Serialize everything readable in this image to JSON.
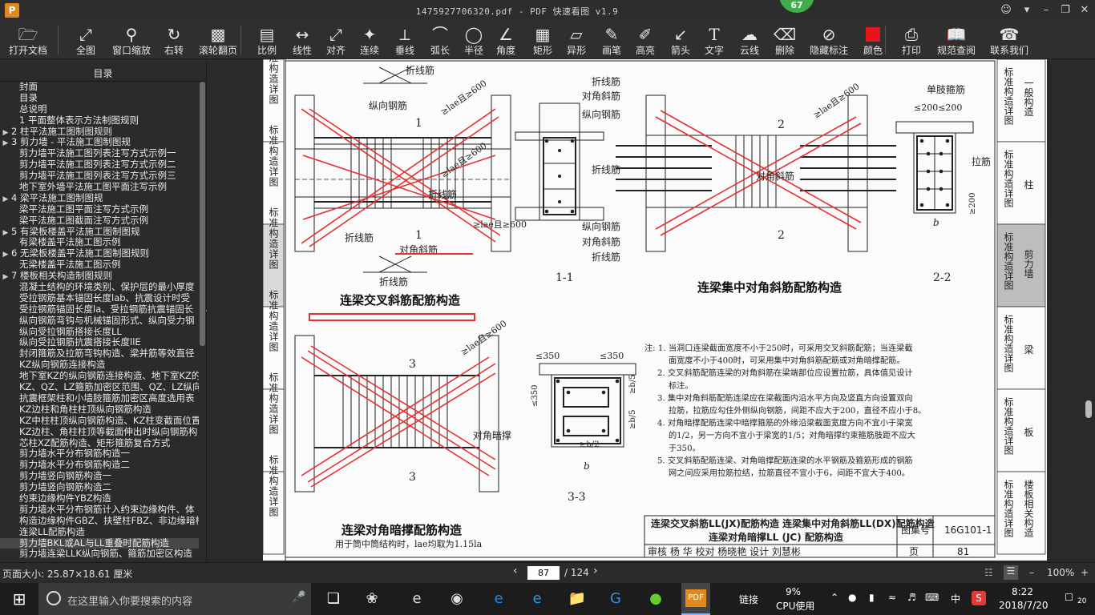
{
  "window": {
    "title": "1475927706320.pdf - PDF 快速看图 v1.9",
    "badge": "67",
    "logo": "P"
  },
  "toolbar": [
    {
      "name": "open",
      "label": "打开文档",
      "icon": "folder-icon"
    },
    {
      "name": "fit",
      "label": "全图",
      "icon": "fit-screen-icon"
    },
    {
      "name": "zoom-window",
      "label": "窗口缩放",
      "icon": "magnifier-icon"
    },
    {
      "name": "rotate",
      "label": "右转",
      "icon": "rotate-icon"
    },
    {
      "name": "scroll-page",
      "label": "滚轮翻页",
      "icon": "mouse-icon"
    },
    {
      "name": "scale",
      "label": "比例",
      "icon": "ruler-icon"
    },
    {
      "name": "linear",
      "label": "线性",
      "icon": "linear-dimension-icon"
    },
    {
      "name": "aligned",
      "label": "对齐",
      "icon": "aligned-dimension-icon"
    },
    {
      "name": "continuous",
      "label": "连续",
      "icon": "continuous-dimension-icon"
    },
    {
      "name": "perpendicular",
      "label": "垂线",
      "icon": "perpendicular-icon"
    },
    {
      "name": "arc-length",
      "label": "弧长",
      "icon": "arc-length-icon"
    },
    {
      "name": "radius",
      "label": "半径",
      "icon": "radius-icon"
    },
    {
      "name": "angle",
      "label": "角度",
      "icon": "angle-icon"
    },
    {
      "name": "rectangle",
      "label": "矩形",
      "icon": "rectangle-icon"
    },
    {
      "name": "irregular",
      "label": "异形",
      "icon": "irregular-shape-icon"
    },
    {
      "name": "pen",
      "label": "画笔",
      "icon": "pen-icon"
    },
    {
      "name": "highlight",
      "label": "高亮",
      "icon": "highlighter-icon"
    },
    {
      "name": "arrow",
      "label": "箭头",
      "icon": "arrow-icon"
    },
    {
      "name": "text",
      "label": "文字",
      "icon": "text-icon"
    },
    {
      "name": "cloud",
      "label": "云线",
      "icon": "cloud-line-icon"
    },
    {
      "name": "delete",
      "label": "删除",
      "icon": "eraser-icon"
    },
    {
      "name": "hide-marks",
      "label": "隐藏标注",
      "icon": "eye-hidden-icon"
    },
    {
      "name": "color",
      "label": "颜色",
      "icon": "color-swatch-icon",
      "color": "#e8141c"
    },
    {
      "name": "print",
      "label": "打印",
      "icon": "printer-icon"
    },
    {
      "name": "standards",
      "label": "规范查阅",
      "icon": "book-icon"
    },
    {
      "name": "contact",
      "label": "联系我们",
      "icon": "headset-icon"
    }
  ],
  "sidebar": {
    "title": "目录",
    "items": [
      {
        "text": "封面",
        "arrow": false
      },
      {
        "text": "目录",
        "arrow": false
      },
      {
        "text": "总说明",
        "arrow": false
      },
      {
        "text": "1 平面整体表示方法制图规则",
        "arrow": false
      },
      {
        "text": "2 柱平法施工图制图规则",
        "arrow": true
      },
      {
        "text": "3 剪力墙 - 平法施工图制图规",
        "arrow": true
      },
      {
        "text": "剪力墙平法施工图列表注写方式示例一",
        "arrow": false
      },
      {
        "text": "剪力墙平法施工图列表注写方式示例二",
        "arrow": false
      },
      {
        "text": "剪力墙平法施工图列表注写方式示例三",
        "arrow": false
      },
      {
        "text": "地下室外墙平法施工图平面注写示例",
        "arrow": false
      },
      {
        "text": "4 梁平法施工图制图规",
        "arrow": true
      },
      {
        "text": "梁平法施工图平面注写方式示例",
        "arrow": false
      },
      {
        "text": "梁平法施工图截面注写方式示例",
        "arrow": false
      },
      {
        "text": "5 有梁板楼盖平法施工图制图规",
        "arrow": true
      },
      {
        "text": "有梁楼盖平法施工图示例",
        "arrow": false
      },
      {
        "text": "6 无梁板楼盖平法施工图制图规则",
        "arrow": true
      },
      {
        "text": "无梁楼盖平法施工图示例",
        "arrow": false
      },
      {
        "text": "7 楼板相关构造制图规则",
        "arrow": true
      },
      {
        "text": "混凝土结构的环境类别、保护层的最小厚度",
        "arrow": false
      },
      {
        "text": "受拉钢筋基本锚固长度lab、抗震设计时受",
        "arrow": false
      },
      {
        "text": "受拉钢筋锚固长度la、受拉钢筋抗震锚固长",
        "arrow": false
      },
      {
        "text": "纵向钢筋弯钩与机械锚固形式、纵向受力钢",
        "arrow": false
      },
      {
        "text": "纵向受拉钢筋搭接长度LL",
        "arrow": false
      },
      {
        "text": "纵向受拉钢筋抗震搭接长度llE",
        "arrow": false
      },
      {
        "text": "封闭箍筋及拉筋弯钩构造、梁并筋等效直径",
        "arrow": false
      },
      {
        "text": "KZ纵向钢筋连接构造",
        "arrow": false
      },
      {
        "text": "地下室KZ的纵向钢筋连接构造、地下室KZ的",
        "arrow": false
      },
      {
        "text": "KZ、QZ、LZ箍筋加密区范围、QZ、LZ纵向钢",
        "arrow": false
      },
      {
        "text": "抗震框架柱和小墙肢箍筋加密区高度选用表",
        "arrow": false
      },
      {
        "text": "KZ边柱和角柱柱顶纵向钢筋构造",
        "arrow": false
      },
      {
        "text": "KZ中柱柱顶纵向钢筋构造、KZ柱变截面位置",
        "arrow": false
      },
      {
        "text": "KZ边柱、角柱柱顶等截面伸出时纵向钢筋构",
        "arrow": false
      },
      {
        "text": "芯柱XZ配筋构造、矩形箍筋复合方式",
        "arrow": false
      },
      {
        "text": "剪力墙水平分布钢筋构造一",
        "arrow": false
      },
      {
        "text": "剪力墙水平分布钢筋构造二",
        "arrow": false
      },
      {
        "text": "剪力墙竖向钢筋构造一",
        "arrow": false
      },
      {
        "text": "剪力墙竖向钢筋构造二",
        "arrow": false
      },
      {
        "text": "约束边缘构件YBZ构造",
        "arrow": false
      },
      {
        "text": "剪力墙水平分布钢筋计入约束边缘构件、体",
        "arrow": false
      },
      {
        "text": "构造边缘构件GBZ、扶壁柱FBZ、非边缘暗柱",
        "arrow": false
      },
      {
        "text": "连梁LL配筋构造",
        "arrow": false
      },
      {
        "text": "剪力墙BKL或AL与LL重叠时配筋构造",
        "arrow": false,
        "selected": true
      },
      {
        "text": "剪力墙连梁LLK纵向钢筋、箍筋加密区构造",
        "arrow": false
      }
    ]
  },
  "page": {
    "right_tabs": [
      {
        "left": "标准构造详图",
        "right": "一般构造"
      },
      {
        "left": "标准构造详图",
        "right": "柱"
      },
      {
        "left": "标准构造详图",
        "right": "剪力墙",
        "active": true
      },
      {
        "left": "标准构造详图",
        "right": "梁"
      },
      {
        "left": "标准构造详图",
        "right": "板"
      },
      {
        "left": "标准构造详图",
        "right": "楼板相关构造"
      }
    ],
    "left_tabs": [
      "标准构造详图",
      "标准构造详图",
      "标准构造详图",
      "标准构造详图",
      "标准构造详图",
      "标准构造详图"
    ],
    "fig1_title": "连梁交叉斜筋配筋构造",
    "fig2_title": "连梁集中对角斜筋配筋构造",
    "fig3_title": "连梁对角暗撑配筋构造",
    "fig3_sub": "用于筒中筒结构时，lae均取为1.15la",
    "sec11": "1-1",
    "sec22": "2-2",
    "sec33": "3-3",
    "labels": {
      "zhexian": "折线筋",
      "zongxiang": "纵向钢筋",
      "duijiao": "对角斜筋",
      "danzhi": "单肢箍筋",
      "lajin": "拉筋",
      "duijiao_an": "对角暗撑",
      "lae600": "≥lae且≥600",
      "le200": "≤200≤200",
      "ge200": "≥200",
      "le350a": "≤350",
      "le350b": "≤350",
      "b": "b",
      "b5a": "≥b/5",
      "b5b": "≥b/5",
      "b2": "≥b/2",
      "n1": "1",
      "n2": "2",
      "n3": "3",
      "le350c": "≤350"
    },
    "notes": [
      "注: 1. 当洞口连梁截面宽度不小于250时，可采用交叉斜筋配筋；当连梁截",
      "面宽度不小于400时，可采用集中对角斜筋配筋或对角暗撑配筋。",
      "2. 交叉斜筋配筋连梁的对角斜筋在梁端部位应设置拉筋，具体值见设计",
      "标注。",
      "3. 集中对角斜筋配筋连梁应在梁截面内沿水平方向及竖直方向设置双向",
      "拉筋，拉筋应勾住外侧纵向钢筋，间距不应大于200，直径不应小于8。",
      "4. 对角暗撑配筋连梁中暗撑箍筋的外缘沿梁截面宽度方向不宜小于梁宽",
      "的1/2，另一方向不宜小于梁宽的1/5；对角暗撑约束箍筋肢距不应大",
      "于350。",
      "5. 交叉斜筋配筋连梁、对角暗撑配筋连梁的水平钢筋及箍筋形成的钢筋",
      "网之间应采用拉筋拉结，拉筋直径不宜小于6，间距不宜大于400。"
    ],
    "titleblock": {
      "line1": "连梁交叉斜筋LL(JX)配筋构造  连梁集中对角斜筋LL(DX)配筋构造",
      "line2": "连梁对角暗撑LL (JC) 配筋构造",
      "atlas_label": "图集号",
      "atlas_no": "16G101-1",
      "row": "审核  杨 华  校对  杨晓艳  设计  刘慧彬",
      "page_label": "页",
      "page_no": "81"
    }
  },
  "status": {
    "page_size": "页面大小: 25.87×18.61 厘米",
    "current_page": "87",
    "total_pages": "/ 124",
    "zoom": "100%"
  },
  "taskbar": {
    "search_placeholder": "在这里输入你要搜索的内容",
    "link_label": "链接",
    "cpu_percent": "9%",
    "cpu_label": "CPU使用",
    "ime": "中",
    "time": "8:22",
    "date": "2018/7/20",
    "notif_count": "20"
  }
}
